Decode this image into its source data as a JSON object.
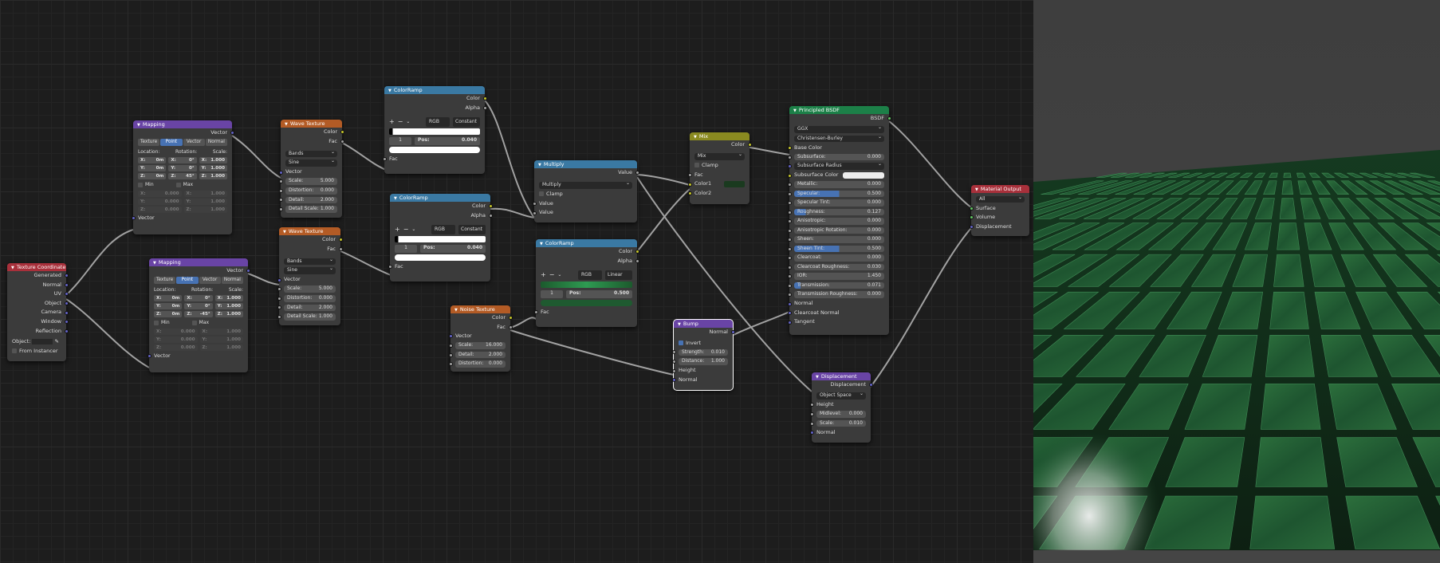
{
  "nodes": {
    "texcoord": {
      "title": "Texture Coordinate",
      "outs": [
        "Generated",
        "Normal",
        "UV",
        "Object",
        "Camera",
        "Window",
        "Reflection"
      ],
      "object_label": "Object:",
      "from_instancer": "From Instancer"
    },
    "map1": {
      "title": "Mapping",
      "out": "Vector",
      "tabs": [
        "Texture",
        "Point",
        "Vector",
        "Normal"
      ],
      "loc": "Location:",
      "rot": "Rotation:",
      "scl": "Scale:",
      "rows": [
        [
          "X:",
          "0m",
          "X:",
          "0°",
          "X:",
          "1.000"
        ],
        [
          "Y:",
          "0m",
          "Y:",
          "0°",
          "Y:",
          "1.000"
        ],
        [
          "Z:",
          "0m",
          "Z:",
          "45°",
          "Z:",
          "1.000"
        ]
      ],
      "min": "Min",
      "max": "Max",
      "mm": [
        [
          "X:",
          "0.000",
          "X:",
          "1.000"
        ],
        [
          "Y:",
          "0.000",
          "Y:",
          "1.000"
        ],
        [
          "Z:",
          "0.000",
          "Z:",
          "1.000"
        ]
      ],
      "in": "Vector"
    },
    "map2": {
      "title": "Mapping",
      "out": "Vector",
      "tabs": [
        "Texture",
        "Point",
        "Vector",
        "Normal"
      ],
      "loc": "Location:",
      "rot": "Rotation:",
      "scl": "Scale:",
      "rows": [
        [
          "X:",
          "0m",
          "X:",
          "0°",
          "X:",
          "1.000"
        ],
        [
          "Y:",
          "0m",
          "Y:",
          "0°",
          "Y:",
          "1.000"
        ],
        [
          "Z:",
          "0m",
          "Z:",
          "-45°",
          "Z:",
          "1.000"
        ]
      ],
      "min": "Min",
      "max": "Max",
      "mm": [
        [
          "X:",
          "0.000",
          "X:",
          "1.000"
        ],
        [
          "Y:",
          "0.000",
          "Y:",
          "1.000"
        ],
        [
          "Z:",
          "0.000",
          "Z:",
          "1.000"
        ]
      ],
      "in": "Vector"
    },
    "wave1": {
      "title": "Wave Texture",
      "outs": [
        "Color",
        "Fac"
      ],
      "d1": "Bands",
      "d2": "Sine",
      "vec": "Vector",
      "fields": [
        [
          "Scale:",
          "5.000"
        ],
        [
          "Distortion:",
          "0.000"
        ],
        [
          "Detail:",
          "2.000"
        ],
        [
          "Detail Scale:",
          "1.000"
        ]
      ]
    },
    "wave2": {
      "title": "Wave Texture",
      "outs": [
        "Color",
        "Fac"
      ],
      "d1": "Bands",
      "d2": "Sine",
      "vec": "Vector",
      "fields": [
        [
          "Scale:",
          "5.000"
        ],
        [
          "Distortion:",
          "0.000"
        ],
        [
          "Detail:",
          "2.000"
        ],
        [
          "Detail Scale:",
          "1.000"
        ]
      ]
    },
    "ramp1": {
      "title": "ColorRamp",
      "outs": [
        "Color",
        "Alpha"
      ],
      "mode": "RGB",
      "interp": "Constant",
      "idx": "1",
      "pos": "Pos:",
      "posv": "0.040",
      "in": "Fac"
    },
    "ramp2": {
      "title": "ColorRamp",
      "outs": [
        "Color",
        "Alpha"
      ],
      "mode": "RGB",
      "interp": "Constant",
      "idx": "1",
      "pos": "Pos:",
      "posv": "0.040",
      "in": "Fac"
    },
    "ramp3": {
      "title": "ColorRamp",
      "outs": [
        "Color",
        "Alpha"
      ],
      "mode": "RGB",
      "interp": "Linear",
      "idx": "1",
      "pos": "Pos:",
      "posv": "0.500",
      "in": "Fac"
    },
    "noise": {
      "title": "Noise Texture",
      "outs": [
        "Color",
        "Fac"
      ],
      "vec": "Vector",
      "fields": [
        [
          "Scale:",
          "16.000"
        ],
        [
          "Detail:",
          "2.000"
        ],
        [
          "Distortion:",
          "0.000"
        ]
      ]
    },
    "multiply": {
      "title": "Multiply",
      "out": "Value",
      "op": "Multiply",
      "clamp": "Clamp",
      "ins": [
        "Value",
        "Value"
      ]
    },
    "mix": {
      "title": "Mix",
      "out": "Color",
      "blend": "Mix",
      "clamp": "Clamp",
      "ins": [
        "Fac",
        "Color1",
        "Color2"
      ]
    },
    "bump": {
      "title": "Bump",
      "out": "Normal",
      "invert": "Invert",
      "fields": [
        [
          "Strength:",
          "0.010"
        ],
        [
          "Distance:",
          "1.000"
        ]
      ],
      "ins": [
        "Height",
        "Normal"
      ]
    },
    "bsdf": {
      "title": "Principled BSDF",
      "out": "BSDF",
      "dist": "GGX",
      "sss": "Christensen-Burley",
      "rows": [
        [
          "Base Color",
          ""
        ],
        [
          "Subsurface:",
          "0.000"
        ],
        [
          "Subsurface Radius",
          ""
        ],
        [
          "Subsurface Color",
          ""
        ],
        [
          "Metallic:",
          "0.000"
        ],
        [
          "Specular:",
          "0.500"
        ],
        [
          "Specular Tint:",
          "0.000"
        ],
        [
          "Roughness:",
          "0.127"
        ],
        [
          "Anisotropic:",
          "0.000"
        ],
        [
          "Anisotropic Rotation:",
          "0.000"
        ],
        [
          "Sheen:",
          "0.000"
        ],
        [
          "Sheen Tint:",
          "0.500"
        ],
        [
          "Clearcoat:",
          "0.000"
        ],
        [
          "Clearcoat Roughness:",
          "0.030"
        ],
        [
          "IOR:",
          "1.450"
        ],
        [
          "Transmission:",
          "0.071"
        ],
        [
          "Transmission Roughness:",
          "0.000"
        ],
        [
          "Normal",
          ""
        ],
        [
          "Clearcoat Normal",
          ""
        ],
        [
          "Tangent",
          ""
        ]
      ]
    },
    "disp": {
      "title": "Displacement",
      "out": "Displacement",
      "space": "Object Space",
      "ins": [
        "Height"
      ],
      "fields": [
        [
          "Midlevel:",
          "0.000"
        ],
        [
          "Scale:",
          "0.010"
        ]
      ],
      "normal": "Normal"
    },
    "out": {
      "title": "Material Output",
      "target": "All",
      "ins": [
        "Surface",
        "Volume",
        "Displacement"
      ]
    }
  },
  "colors": {
    "green_dark": "#1a3a1f",
    "green_ramp_a": "#1c5a2d",
    "green_ramp_b": "#2e9b52",
    "tile_green": "#1f5a30"
  }
}
